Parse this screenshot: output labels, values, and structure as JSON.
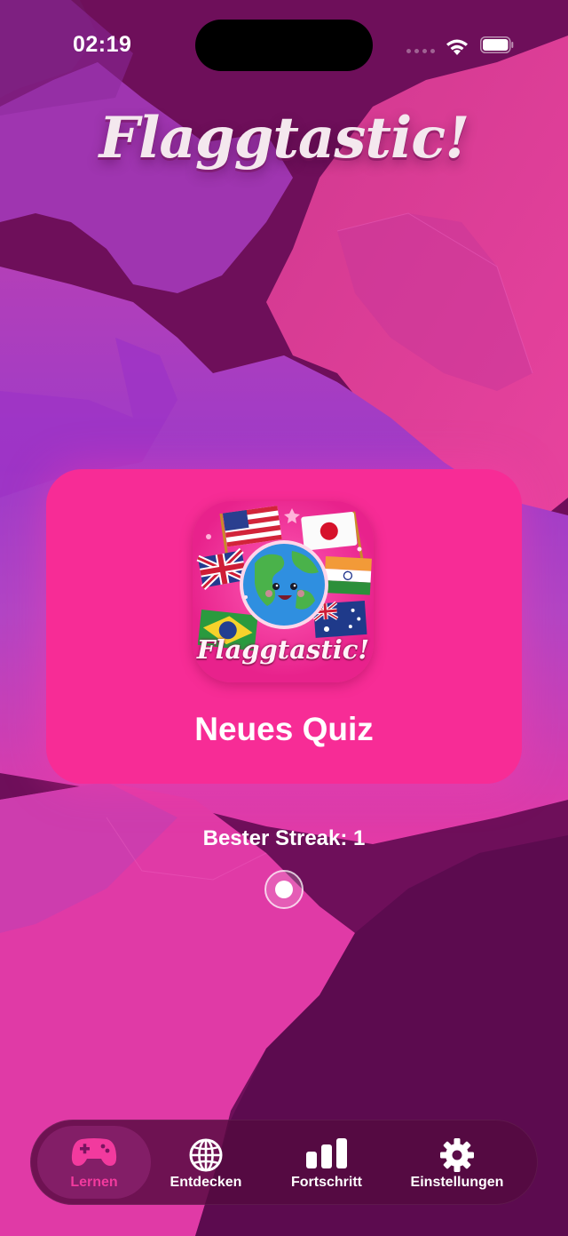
{
  "status_bar": {
    "time": "02:19"
  },
  "app": {
    "title": "Flaggtastic!"
  },
  "quiz_card": {
    "logo_wordmark": "Flaggtastic!",
    "label": "Neues Quiz"
  },
  "streak": {
    "text": "Bester Streak: 1"
  },
  "tab_bar": {
    "active": "Lernen",
    "items": [
      {
        "label": "Lernen",
        "icon": "gamepad-icon"
      },
      {
        "label": "Entdecken",
        "icon": "globe-icon"
      },
      {
        "label": "Fortschritt",
        "icon": "bar-chart-icon"
      },
      {
        "label": "Einstellungen",
        "icon": "gear-icon"
      }
    ]
  },
  "colors": {
    "accent": "#f72c96",
    "active_tab": "#f23a9e",
    "text": "#ffffff"
  }
}
